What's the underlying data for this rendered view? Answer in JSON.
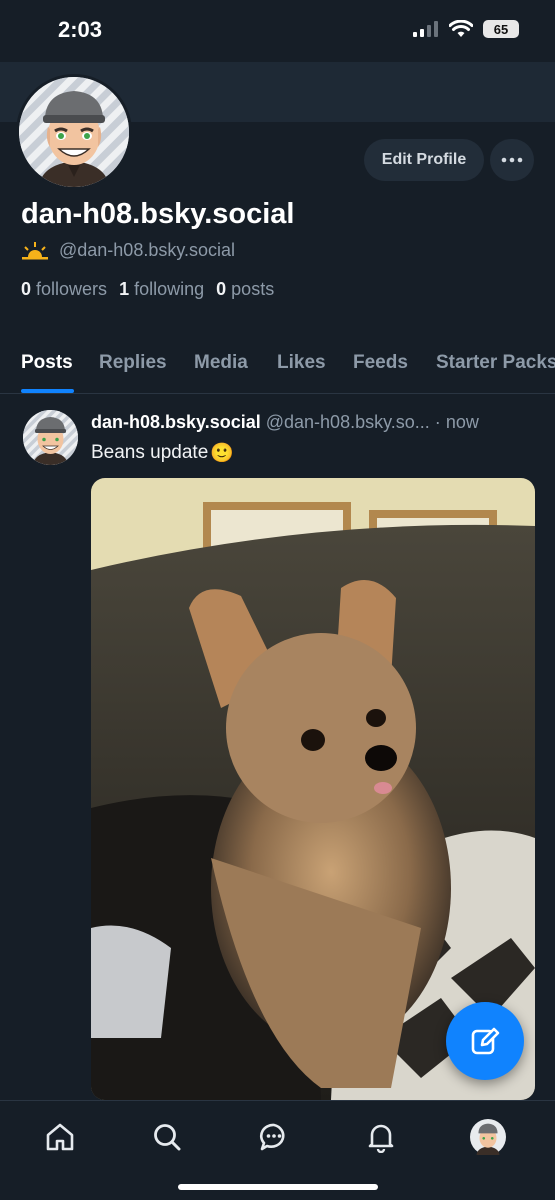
{
  "status_bar": {
    "time": "2:03",
    "battery": "65"
  },
  "profile": {
    "display_name": "dan-h08.bsky.social",
    "handle": "@dan-h08.bsky.social",
    "edit_label": "Edit Profile",
    "followers_count": "0",
    "followers_label": "followers",
    "following_count": "1",
    "following_label": "following",
    "posts_count": "0",
    "posts_label": "posts"
  },
  "tabs": [
    {
      "label": "Posts",
      "active": true
    },
    {
      "label": "Replies"
    },
    {
      "label": "Media"
    },
    {
      "label": "Likes"
    },
    {
      "label": "Feeds"
    },
    {
      "label": "Starter Packs"
    }
  ],
  "post": {
    "author": "dan-h08.bsky.social",
    "handle": "@dan-h08.bsky.so...",
    "separator": "·",
    "time": "now",
    "text": "Beans update",
    "emoji": "🙂"
  },
  "nav": {
    "icons": [
      "home-icon",
      "search-icon",
      "chat-icon",
      "bell-icon",
      "profile-avatar"
    ]
  },
  "colors": {
    "accent": "#1083fe",
    "background": "#161e27",
    "muted": "#8d9aa8"
  }
}
